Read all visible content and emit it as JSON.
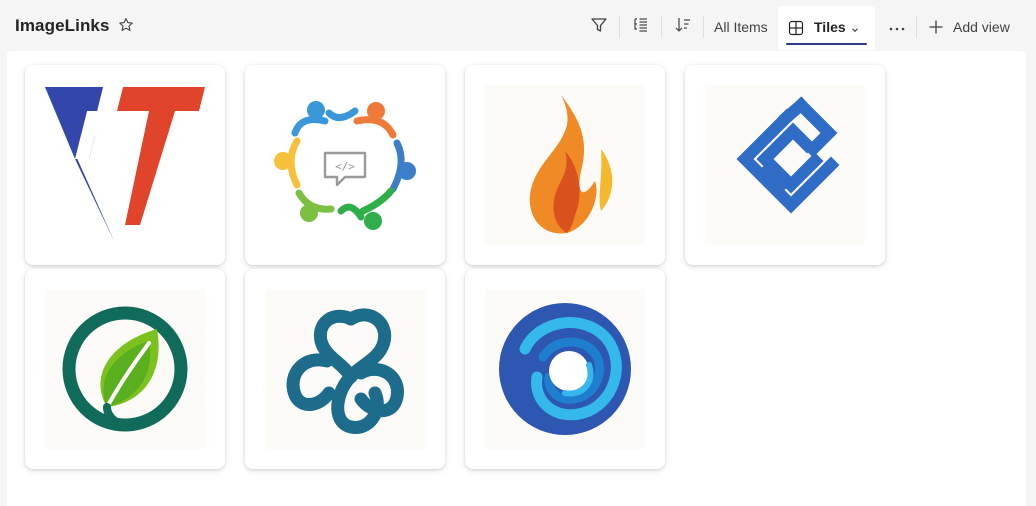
{
  "header": {
    "title": "ImageLinks",
    "views": {
      "all_items_label": "All Items",
      "active_view_label": "Tiles",
      "add_view_label": "Add view"
    }
  },
  "toolbar": {
    "icons": [
      "filter-icon",
      "group-by-icon",
      "sort-icon",
      "more-options-icon",
      "add-icon"
    ]
  },
  "tiles": [
    {
      "logo": "ft-letters-logo"
    },
    {
      "logo": "people-circle-code-logo"
    },
    {
      "logo": "flame-logo"
    },
    {
      "logo": "chain-c-logo"
    },
    {
      "logo": "leaf-circle-logo"
    },
    {
      "logo": "knot-logo"
    },
    {
      "logo": "swirl-circle-logo"
    }
  ],
  "colors": {
    "accent": "#2f3c8c",
    "background": "#f5f5f5",
    "panel": "#ffffff"
  }
}
